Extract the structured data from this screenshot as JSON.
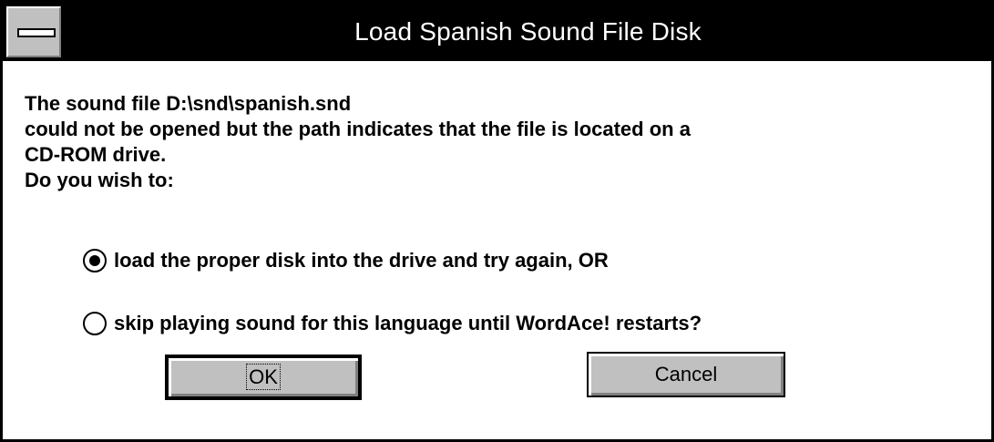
{
  "window": {
    "title": "Load Spanish Sound File Disk"
  },
  "message": {
    "lines": [
      "The sound file D:\\snd\\spanish.snd",
      "could not be opened but the path indicates that the file is located on a",
      "CD-ROM drive.",
      "Do you wish to:"
    ]
  },
  "options": [
    {
      "label": "load the proper disk into the drive and try again, OR",
      "selected": true
    },
    {
      "label": "skip playing sound for this language until WordAce! restarts?",
      "selected": false
    }
  ],
  "buttons": {
    "ok_label": "OK",
    "cancel_label": "Cancel"
  },
  "icons": {
    "system_menu": "system-menu-icon"
  },
  "colors": {
    "titlebar": "#000000",
    "title_text": "#ffffff",
    "button_face": "#c0c0c0",
    "background": "#ffffff"
  }
}
